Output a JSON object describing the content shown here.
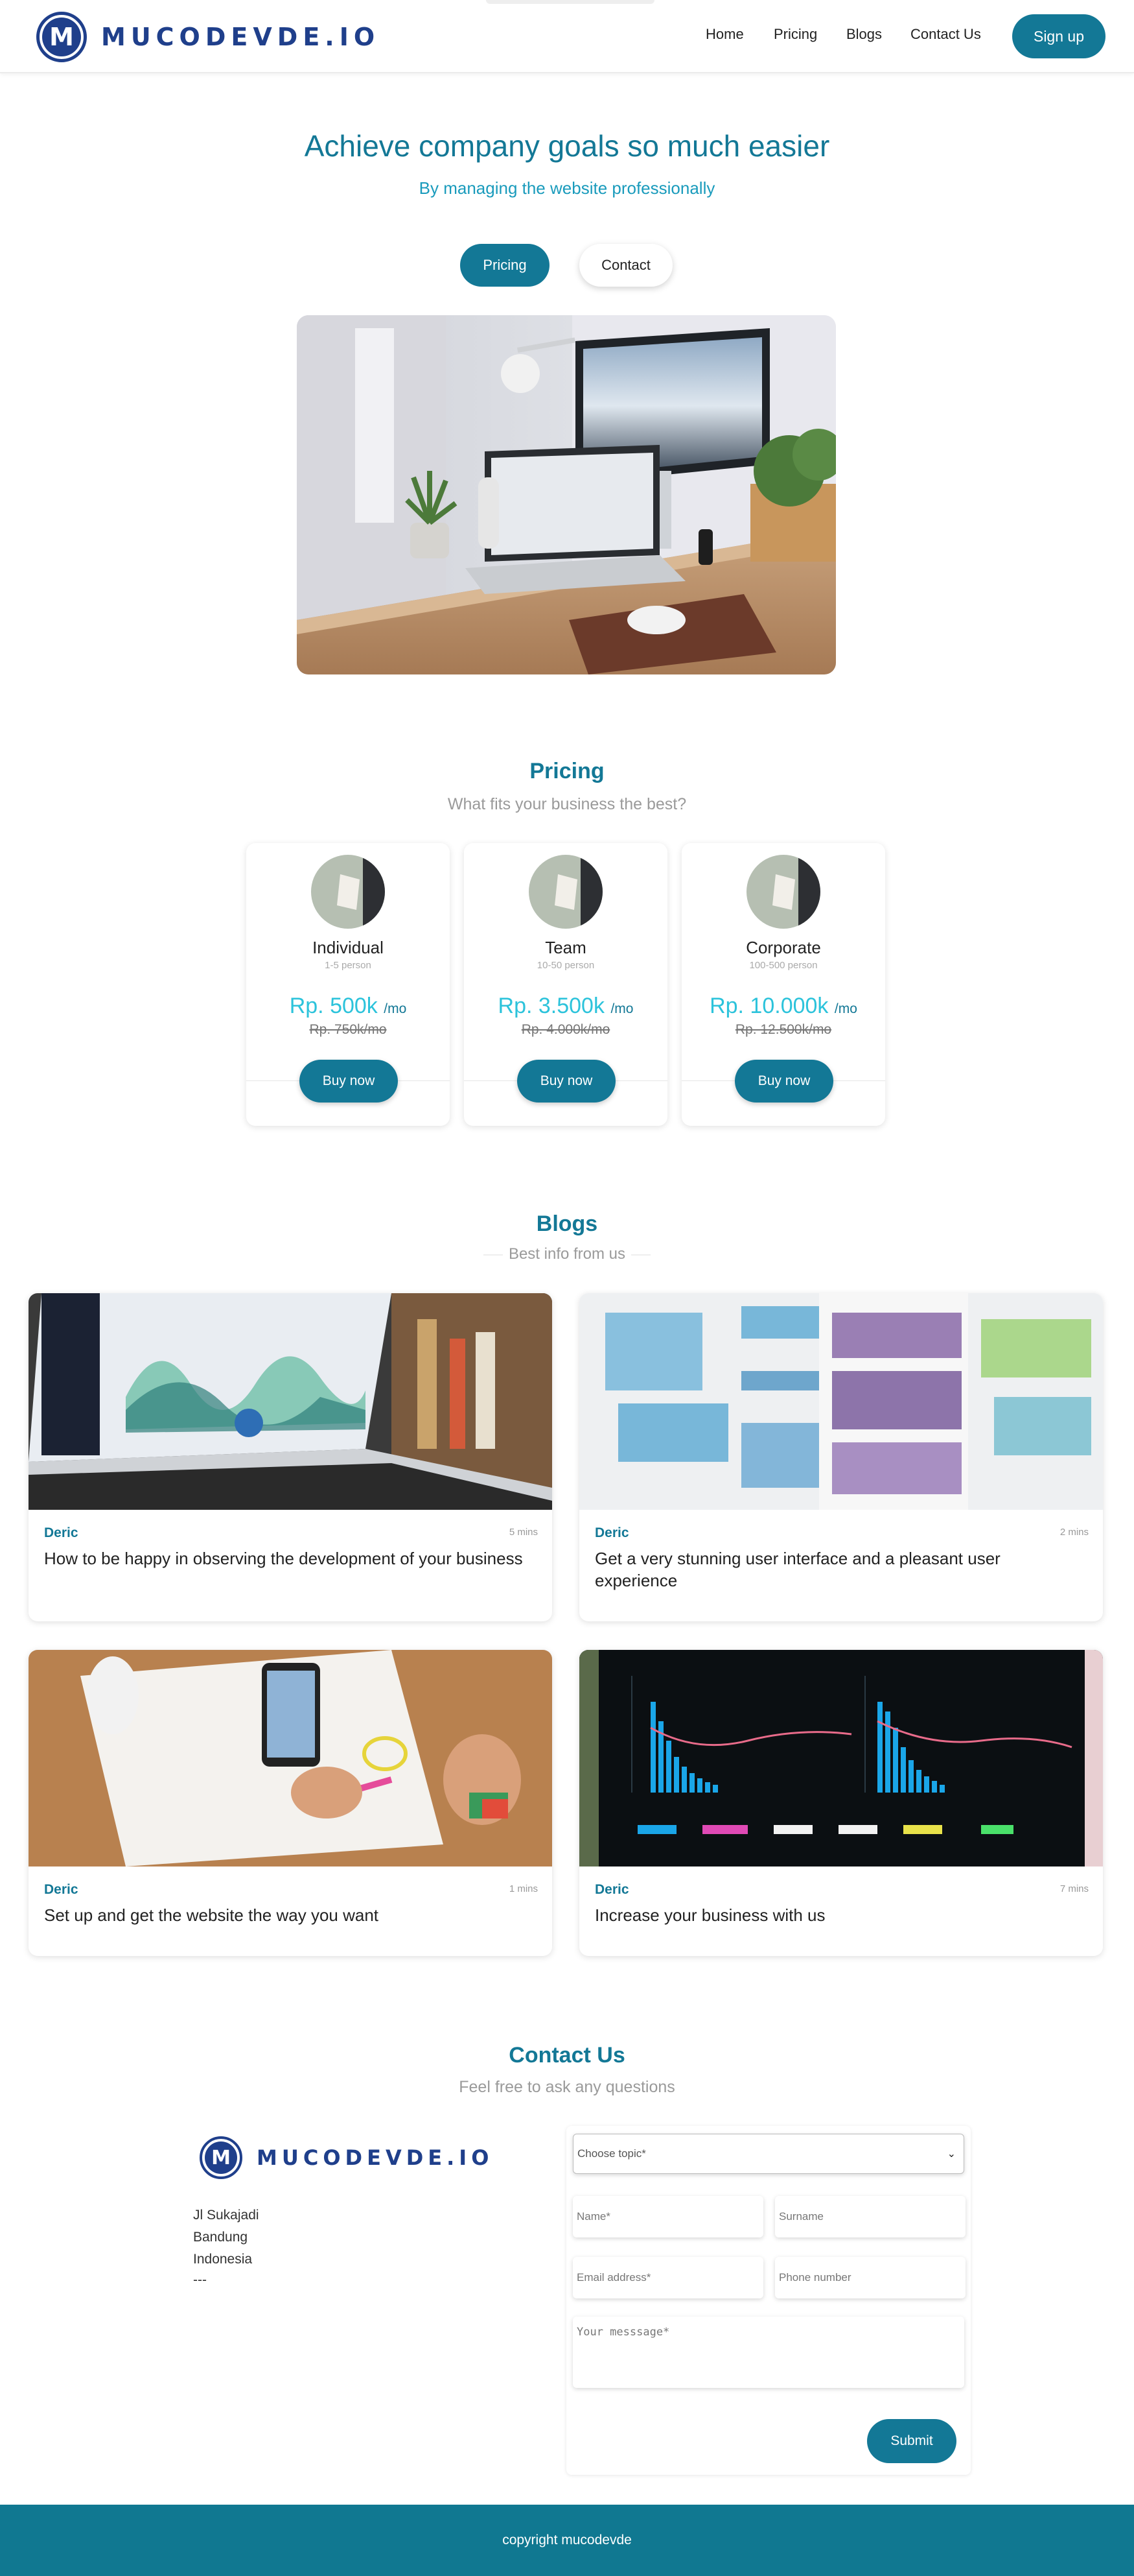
{
  "brand": {
    "name": "MUCODEVDE.IO",
    "mark": "M"
  },
  "nav": {
    "links": [
      "Home",
      "Pricing",
      "Blogs",
      "Contact Us"
    ],
    "signup_label": "Sign up"
  },
  "hero": {
    "title": "Achieve company goals so much easier",
    "subtitle": "By managing the website professionally",
    "primary_button": "Pricing",
    "secondary_button": "Contact",
    "image_icon": "desk-workspace-photo"
  },
  "pricing": {
    "title": "Pricing",
    "subtitle": "What fits your business the best?",
    "plans": [
      {
        "name": "Individual",
        "size": "1-5 person",
        "price": "Rp. 500k",
        "per": "/mo",
        "old_price": "Rp. 750k/mo",
        "button": "Buy now"
      },
      {
        "name": "Team",
        "size": "10-50 person",
        "price": "Rp. 3.500k",
        "per": "/mo",
        "old_price": "Rp. 4.000k/mo",
        "button": "Buy now"
      },
      {
        "name": "Corporate",
        "size": "100-500 person",
        "price": "Rp. 10.000k",
        "per": "/mo",
        "old_price": "Rp. 12.500k/mo",
        "button": "Buy now"
      }
    ]
  },
  "blogs": {
    "title": "Blogs",
    "subtitle": "Best info from us",
    "posts": [
      {
        "author": "Deric",
        "time": "5 mins",
        "title": "How to be happy in observing the development of your business",
        "image_icon": "laptop-dashboard-photo"
      },
      {
        "author": "Deric",
        "time": "2 mins",
        "title": "Get a very stunning user interface and a pleasant user experience",
        "image_icon": "wireframe-sketch-photo"
      },
      {
        "author": "Deric",
        "time": "1 mins",
        "title": "Set up and get the website the way you want",
        "image_icon": "desk-planning-photo"
      },
      {
        "author": "Deric",
        "time": "7 mins",
        "title": "Increase your business with us",
        "image_icon": "analytics-screen-photo"
      }
    ]
  },
  "contact": {
    "title": "Contact Us",
    "subtitle": "Feel free to ask any questions",
    "address": [
      "Jl Sukajadi",
      "Bandung",
      "Indonesia",
      "---"
    ],
    "form": {
      "topic_placeholder": "Choose topic*",
      "name_placeholder": "Name*",
      "surname_placeholder": "Surname",
      "email_placeholder": "Email address*",
      "phone_placeholder": "Phone number",
      "message_placeholder": "Your messsage*",
      "submit_label": "Submit"
    }
  },
  "footer": {
    "text": "copyright mucodevde"
  },
  "colors": {
    "primary": "#137896",
    "accent": "#2cc3db",
    "brand": "#1f3f8b"
  }
}
